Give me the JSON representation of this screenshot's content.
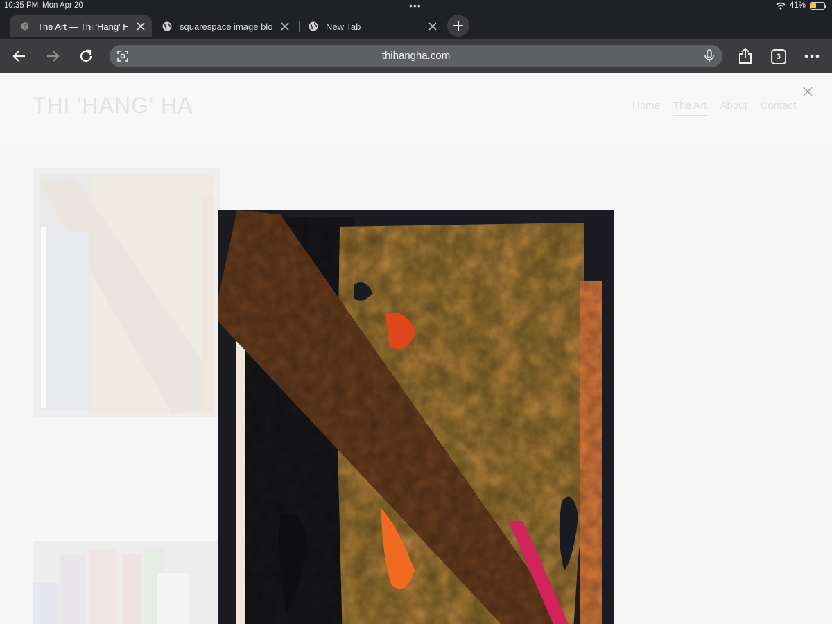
{
  "status": {
    "time": "10:35 PM",
    "date": "Mon Apr 20",
    "battery_text": "41%",
    "battery_level": 0.41
  },
  "tabs": [
    {
      "title": "The Art — Thi 'Hang' Ha",
      "active": true
    },
    {
      "title": "squarespace image bloc",
      "active": false
    },
    {
      "title": "New Tab",
      "active": false
    }
  ],
  "toolbar": {
    "url": "thihangha.com",
    "tab_count": "3"
  },
  "site": {
    "title": "THI 'HANG' HA",
    "nav": [
      "Home",
      "The Art",
      "About",
      "Contact"
    ],
    "active_nav": "The Art"
  },
  "icons": {
    "back": "back-arrow-icon",
    "forward": "forward-arrow-icon",
    "reload": "reload-icon",
    "lens": "lens-icon",
    "mic": "mic-icon",
    "share": "share-icon",
    "more": "more-icon",
    "close": "close-icon"
  }
}
